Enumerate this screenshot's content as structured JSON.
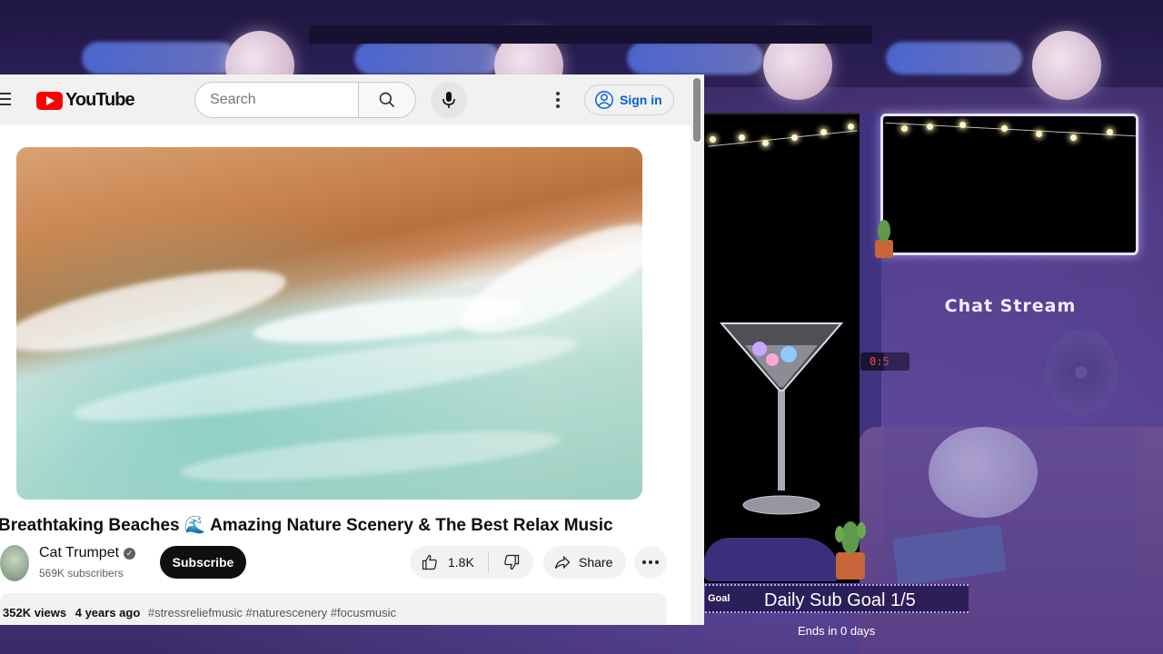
{
  "youtube": {
    "logo_text": "YouTube",
    "search_placeholder": "Search",
    "sign_in_label": "Sign in",
    "video": {
      "title": "Breathtaking Beaches 🌊 Amazing Nature Scenery & The Best Relax Music",
      "channel_name": "Cat Trumpet",
      "subscribers": "569K subscribers",
      "subscribe_label": "Subscribe",
      "likes": "1.8K",
      "share_label": "Share",
      "views": "352K views",
      "age": "4 years ago",
      "tags": "#stressreliefmusic #naturescenery #focusmusic"
    }
  },
  "overlay": {
    "chat_title": "Chat Stream",
    "goal_label": "Goal",
    "goal_text": "Daily Sub Goal 1/5",
    "goal_ends": "Ends in 0 days",
    "clock_text": "0:5"
  },
  "colors": {
    "youtube_red": "#ff0000",
    "link_blue": "#065fd4",
    "scene_purple": "#4a3a82"
  }
}
